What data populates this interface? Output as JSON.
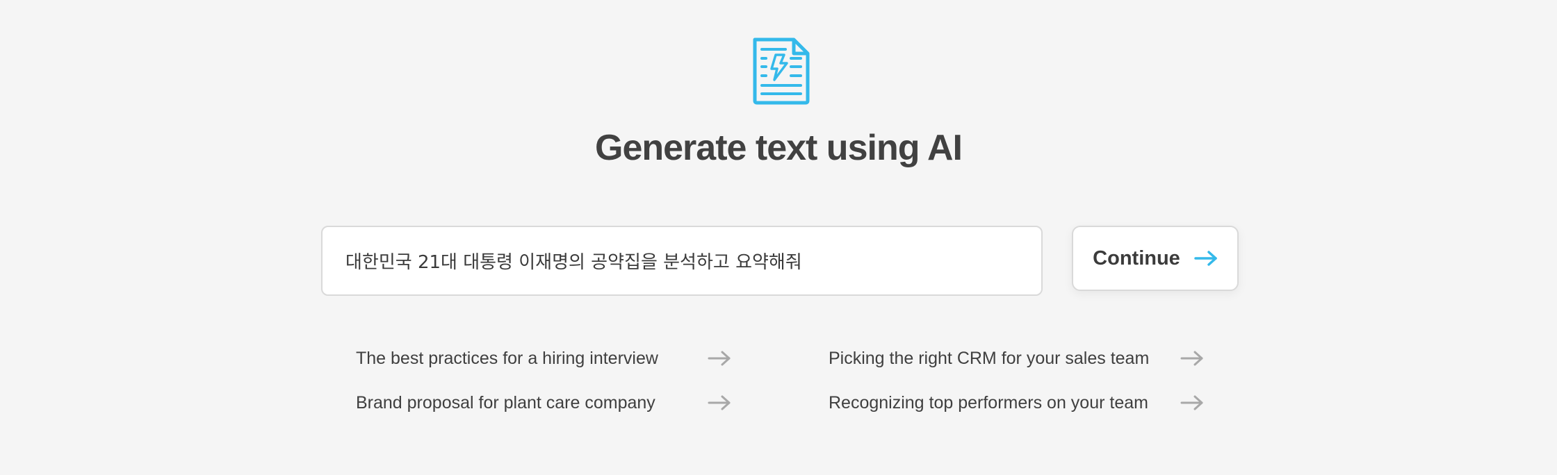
{
  "header": {
    "icon": "document-lightning-icon",
    "title": "Generate text using AI"
  },
  "prompt": {
    "value": "대한민국 21대 대통령 이재명의 공약집을 분석하고 요약해줘"
  },
  "continue_button": {
    "label": "Continue",
    "icon": "arrow-right-icon"
  },
  "suggestions": [
    {
      "label": "The best practices for a hiring interview",
      "icon": "arrow-right-icon"
    },
    {
      "label": "Picking the right CRM for your sales team",
      "icon": "arrow-right-icon"
    },
    {
      "label": "Brand proposal for plant care company",
      "icon": "arrow-right-icon"
    },
    {
      "label": "Recognizing top performers on your team",
      "icon": "arrow-right-icon"
    }
  ],
  "colors": {
    "accent": "#34b9ea",
    "background": "#f5f5f5",
    "text": "#3f3f3f",
    "arrow_muted": "#a8a8a8"
  }
}
